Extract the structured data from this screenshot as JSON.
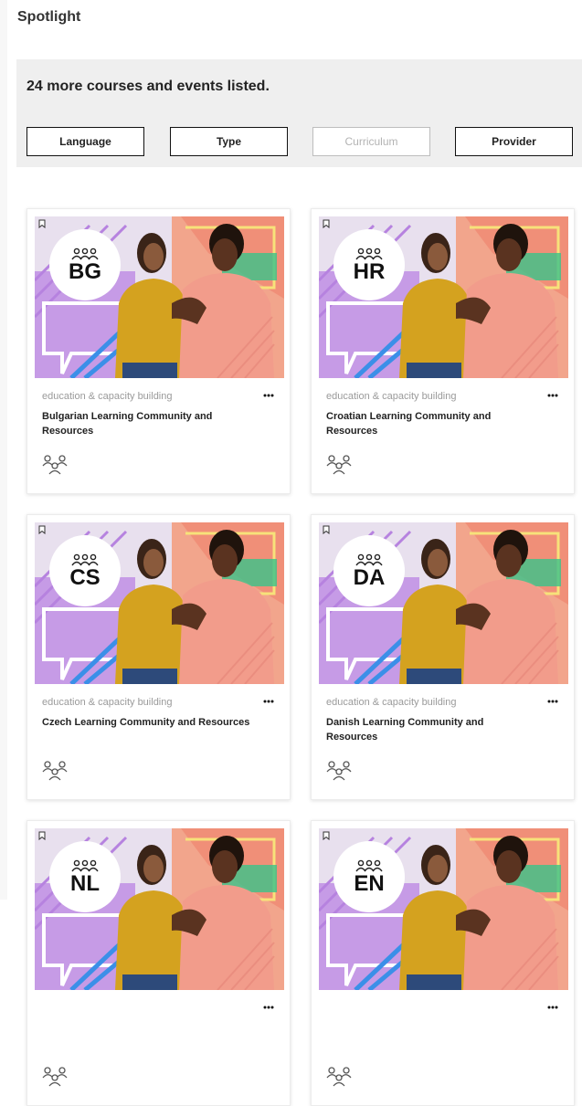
{
  "page": {
    "heading": "Spotlight"
  },
  "filters": {
    "summary": "24 more courses and events listed.",
    "buttons": [
      {
        "label": "Language",
        "disabled": false
      },
      {
        "label": "Type",
        "disabled": false
      },
      {
        "label": "Curriculum",
        "disabled": true
      },
      {
        "label": "Provider",
        "disabled": false
      }
    ]
  },
  "cards": [
    {
      "code": "BG",
      "category": "education & capacity building",
      "title": "Bulgarian Learning Community and Resources",
      "icon": "community-icon"
    },
    {
      "code": "HR",
      "category": "education & capacity building",
      "title": "Croatian Learning Community and Resources",
      "icon": "community-icon"
    },
    {
      "code": "CS",
      "category": "education & capacity building",
      "title": "Czech Learning Community and Resources",
      "icon": "community-icon"
    },
    {
      "code": "DA",
      "category": "education & capacity building",
      "title": "Danish Learning Community and Resources",
      "icon": "community-icon"
    },
    {
      "code": "NL",
      "category": "",
      "title": "",
      "icon": "community-icon"
    },
    {
      "code": "EN",
      "category": "",
      "title": "",
      "icon": "community-icon"
    }
  ],
  "colors": {
    "panel_background": "#efefef",
    "image_background": "#f2a58c",
    "image_purple": "#c69be6",
    "image_green": "#39c38a",
    "sweater_yellow": "#d4a21f",
    "shirt_salmon": "#f29c8b"
  }
}
